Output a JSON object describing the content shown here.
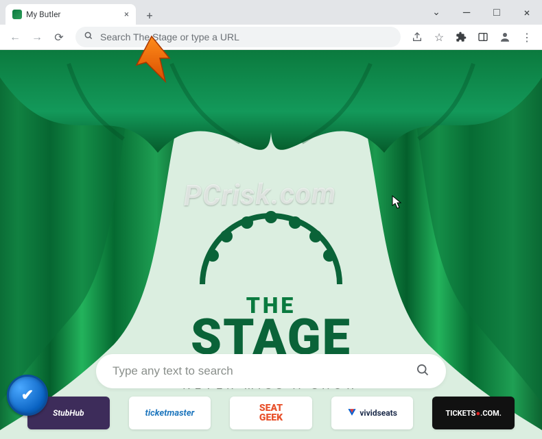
{
  "tab": {
    "title": "My Butler"
  },
  "omnibox": {
    "placeholder": "Search The Stage or type a URL"
  },
  "logo": {
    "the": "THE",
    "stage": "STAGE",
    "tagline": "NEVER MISS A SHOW"
  },
  "search": {
    "placeholder": "Type any text to search"
  },
  "links": {
    "stubhub": "StubHub",
    "ticketmaster": "ticketmaster",
    "seatgeek_line1": "SEAT",
    "seatgeek_line2": "GEEK",
    "vividseats": "vividseats",
    "tickets": "TICKETS",
    "tickets_suffix": ".COM."
  },
  "watermark": "PCrisk.com"
}
